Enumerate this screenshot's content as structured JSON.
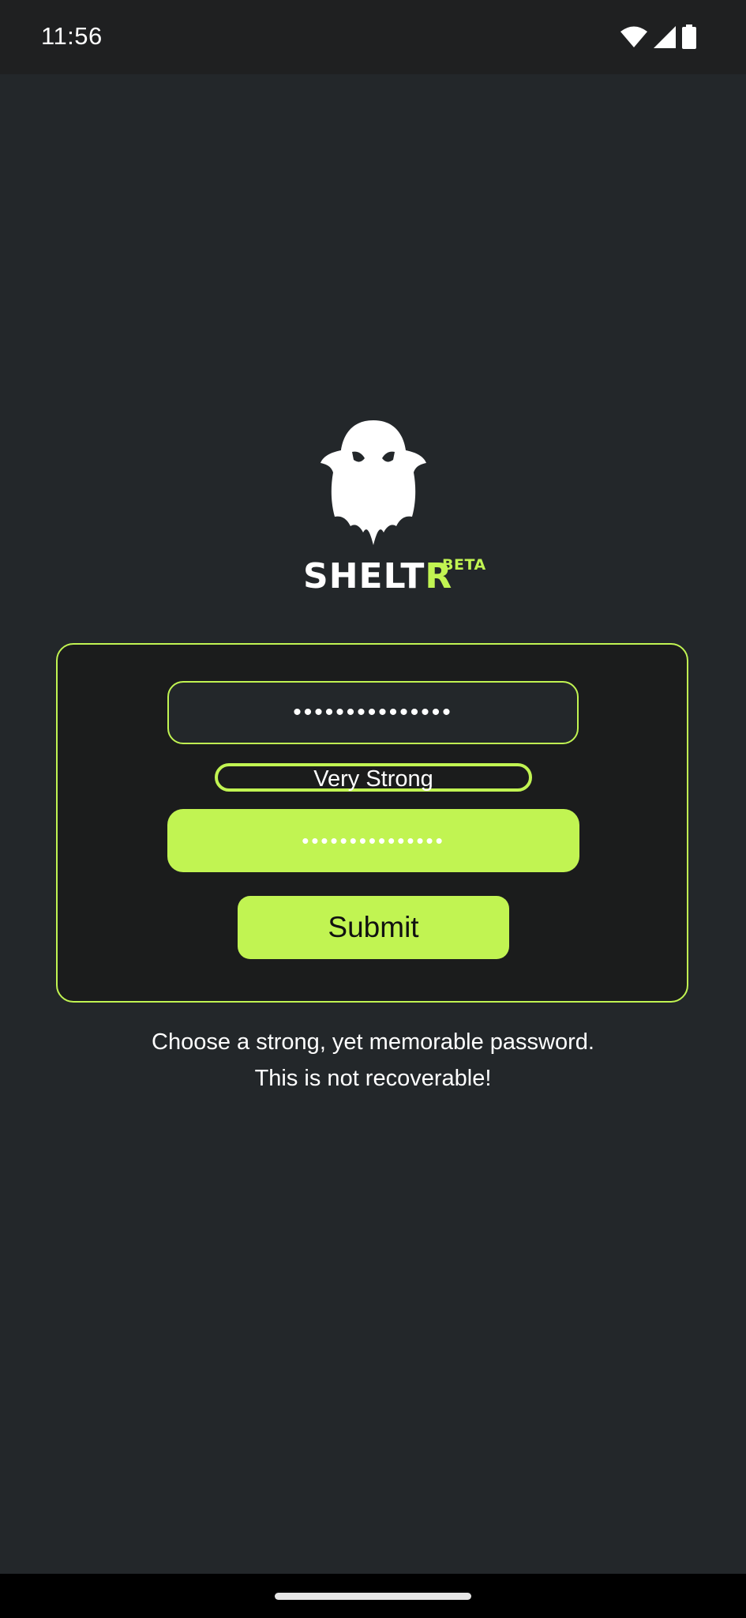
{
  "status_bar": {
    "time": "11:56",
    "icons": [
      "wifi-icon",
      "cellular-signal-icon",
      "battery-icon"
    ]
  },
  "logo": {
    "icon": "ghost-icon",
    "brand_prefix": "SHELT",
    "brand_suffix": "R",
    "badge": "BETA"
  },
  "form": {
    "password_value": "•••••••••••••••",
    "strength_label": "Very Strong",
    "confirm_value": "•••••••••••••••",
    "submit_label": "Submit"
  },
  "helper": {
    "line1": "Choose a strong, yet memorable password.",
    "line2": "This is not recoverable!"
  },
  "colors": {
    "accent": "#c1f452",
    "background": "#23272a",
    "card": "#1b1c1c"
  }
}
